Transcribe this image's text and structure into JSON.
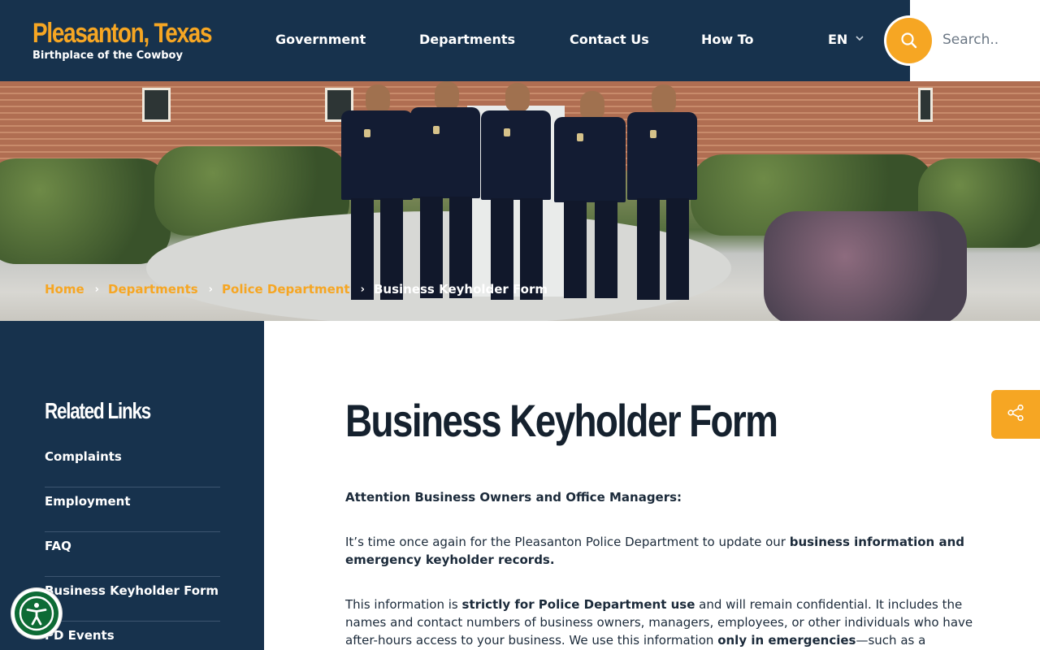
{
  "header": {
    "logo_title": "Pleasanton, Texas",
    "logo_subtitle": "Birthplace of the Cowboy",
    "nav": [
      {
        "label": "Government"
      },
      {
        "label": "Departments"
      },
      {
        "label": "Contact Us"
      },
      {
        "label": "How To"
      }
    ],
    "language": "EN",
    "search_placeholder": "Search.."
  },
  "breadcrumb": {
    "items": [
      "Home",
      "Departments",
      "Police Department"
    ],
    "current": "Business Keyholder Form"
  },
  "sidebar": {
    "title": "Related Links",
    "items": [
      {
        "label": "Complaints"
      },
      {
        "label": "Employment"
      },
      {
        "label": "FAQ"
      },
      {
        "label": "Business Keyholder Form"
      },
      {
        "label": "PD Events"
      }
    ]
  },
  "main": {
    "title": "Business Keyholder Form",
    "p1": "Attention Business Owners and Office Managers:",
    "p2_a": "It’s time once again for the Pleasanton Police Department to update our ",
    "p2_b": "business information and emergency keyholder records.",
    "p3_a": "This information is ",
    "p3_b": "strictly for Police Department use",
    "p3_c": " and will remain confidential. It includes the names and contact numbers of business owners, managers, employees, or other individuals who have after-hours access to your business. We use this information ",
    "p3_d": "only in emergencies",
    "p3_e": "—such as a"
  },
  "colors": {
    "navy": "#17324d",
    "accent_orange": "#f6a623",
    "accessibility_green": "#0d6b35"
  },
  "icons": {
    "search": "search-icon",
    "share": "share-icon",
    "accessibility": "accessibility-icon",
    "language_dropdown": "chevron-down-icon"
  }
}
